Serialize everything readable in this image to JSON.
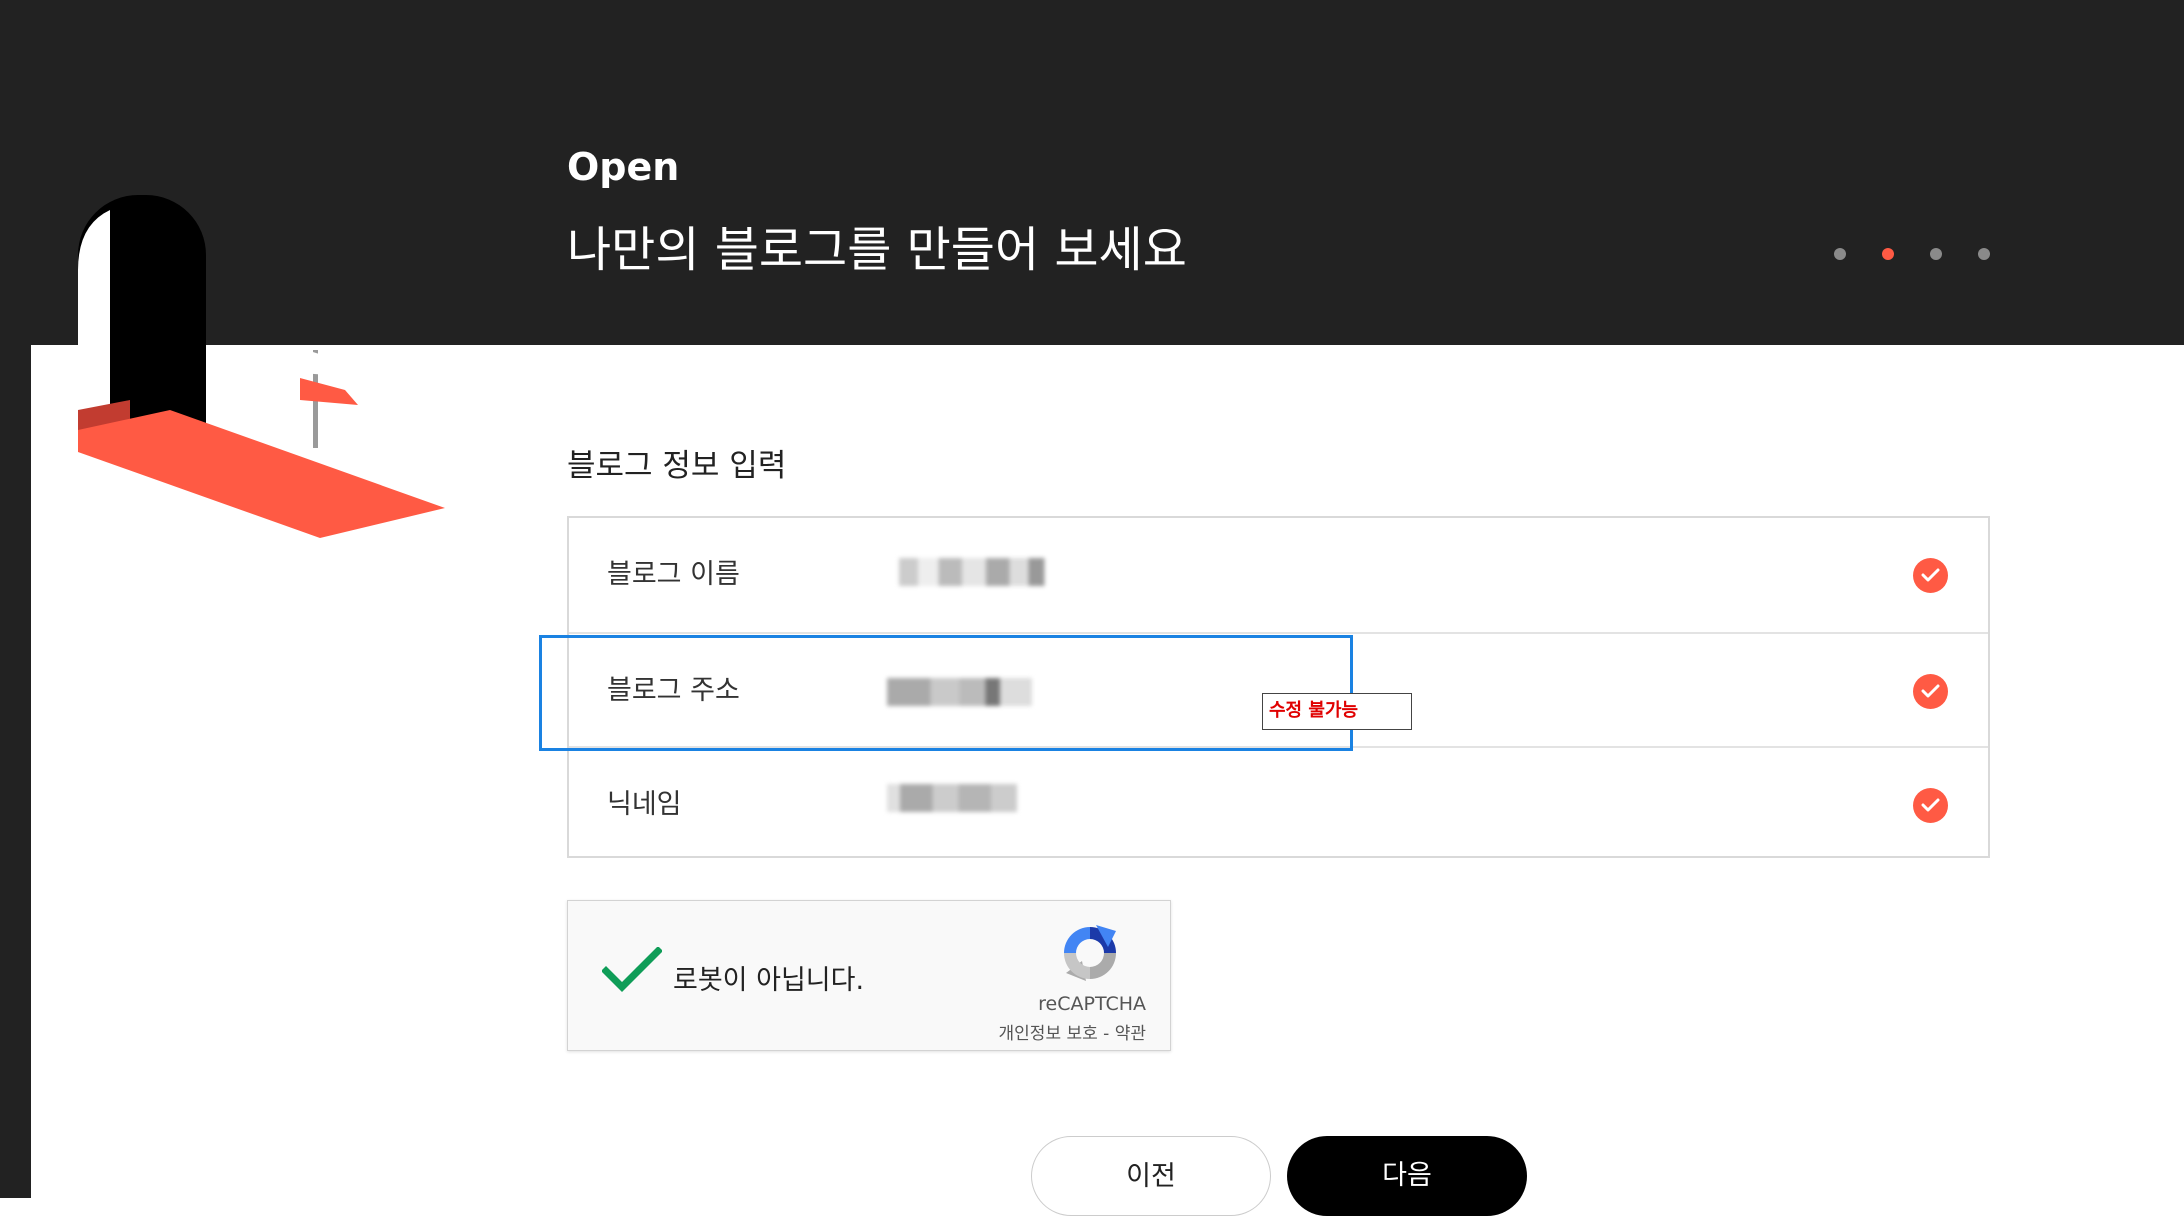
{
  "header": {
    "brand": "Open",
    "headline": "나만의 블로그를 만들어 보세요",
    "steps": {
      "total": 4,
      "current": 2
    }
  },
  "form": {
    "section_title": "블로그 정보 입력",
    "rows": [
      {
        "label": "블로그 이름",
        "icon": "check-circle-icon"
      },
      {
        "label": "블로그 주소",
        "icon": "check-circle-icon"
      },
      {
        "label": "닉네임",
        "icon": "check-circle-icon"
      }
    ],
    "annotation": "수정 불가능"
  },
  "captcha": {
    "label": "로봇이 아닙니다.",
    "brand": "reCAPTCHA",
    "links": "개인정보 보호 - 약관"
  },
  "buttons": {
    "prev": "이전",
    "next": "다음"
  },
  "colors": {
    "accent": "#ff5a44",
    "dark": "#222222",
    "highlight": "#1a82e2"
  }
}
